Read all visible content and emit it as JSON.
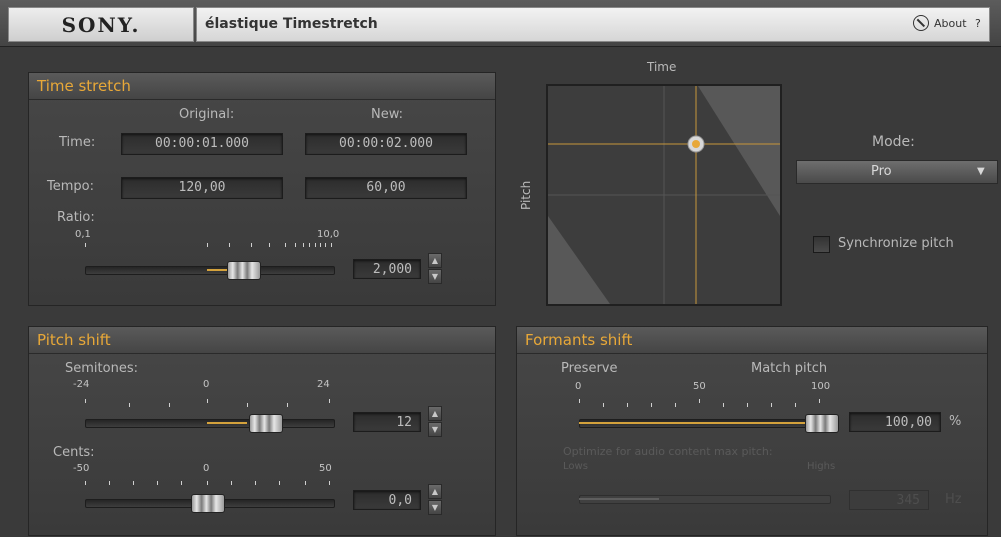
{
  "header": {
    "brand": "SONY.",
    "title": "élastique Timestretch",
    "about_label": "About",
    "help_label": "?"
  },
  "time_stretch": {
    "title": "Time stretch",
    "col_original": "Original:",
    "col_new": "New:",
    "time_label": "Time:",
    "time_original": "00:00:01.000",
    "time_new": "00:00:02.000",
    "tempo_label": "Tempo:",
    "tempo_original": "120,00",
    "tempo_new": "60,00",
    "ratio_label": "Ratio:",
    "ratio_min": "0,1",
    "ratio_max": "10,0",
    "ratio_value": "2,000"
  },
  "xy_pad": {
    "x_label": "Time",
    "y_label": "Pitch"
  },
  "mode": {
    "label": "Mode:",
    "selected": "Pro",
    "sync_label": "Synchronize pitch",
    "sync_checked": false
  },
  "pitch_shift": {
    "title": "Pitch shift",
    "semitones_label": "Semitones:",
    "semi_min": "-24",
    "semi_mid": "0",
    "semi_max": "24",
    "semitones_value": "12",
    "cents_label": "Cents:",
    "cents_min": "-50",
    "cents_mid": "0",
    "cents_max": "50",
    "cents_value": "0,0"
  },
  "formants_shift": {
    "title": "Formants shift",
    "preserve_label": "Preserve",
    "match_label": "Match pitch",
    "scale_0": "0",
    "scale_50": "50",
    "scale_100": "100",
    "value": "100,00",
    "unit": "%",
    "optimize_label": "Optimize for audio content max pitch:",
    "lows_label": "Lows",
    "highs_label": "Highs",
    "max_pitch_value": "345",
    "max_pitch_unit": "Hz"
  },
  "colors": {
    "accent": "#e8a838",
    "background": "#3a3a3a"
  }
}
